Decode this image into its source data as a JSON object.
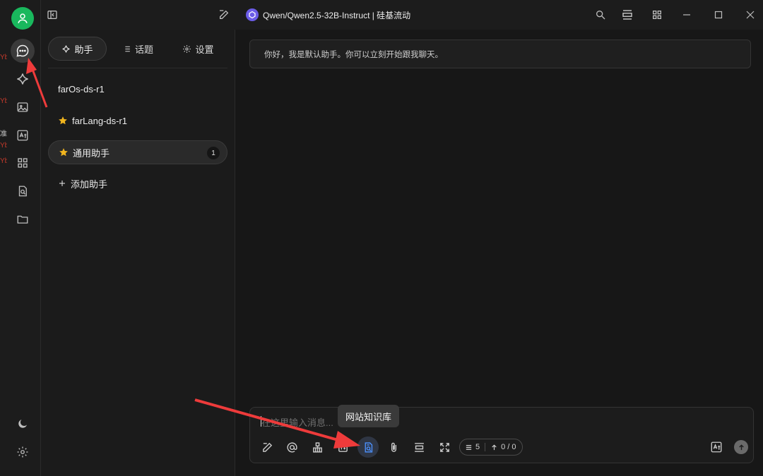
{
  "window": {
    "model_title": "Qwen/Qwen2.5-32B-Instruct | 硅基流动"
  },
  "panel": {
    "tabs": [
      {
        "label": "助手",
        "icon": "sparkle-icon"
      },
      {
        "label": "话题",
        "icon": "list-icon"
      },
      {
        "label": "设置",
        "icon": "gear-icon"
      }
    ],
    "assistants": [
      {
        "name": "farOs-ds-r1",
        "icon": ""
      },
      {
        "name": "farLang-ds-r1",
        "icon": "star-icon"
      },
      {
        "name": "通用助手",
        "icon": "star-icon",
        "badge": "1"
      }
    ],
    "add_label": "添加助手"
  },
  "chat": {
    "welcome": "你好，我是默认助手。你可以立刻开始跟我聊天。",
    "input_placeholder": "在这里输入消息...",
    "tooltip": "网站知识库",
    "context_count": "5",
    "token_count": "0 / 0"
  },
  "rail": {
    "edge_fragments": [
      "Yb",
      "Yb",
      "准",
      "Yb",
      "Yb"
    ]
  },
  "colors": {
    "accent": "#4b8ef7",
    "avatar": "#19b85d",
    "arrow": "#ee3b3b",
    "star": "#f0b41e"
  }
}
